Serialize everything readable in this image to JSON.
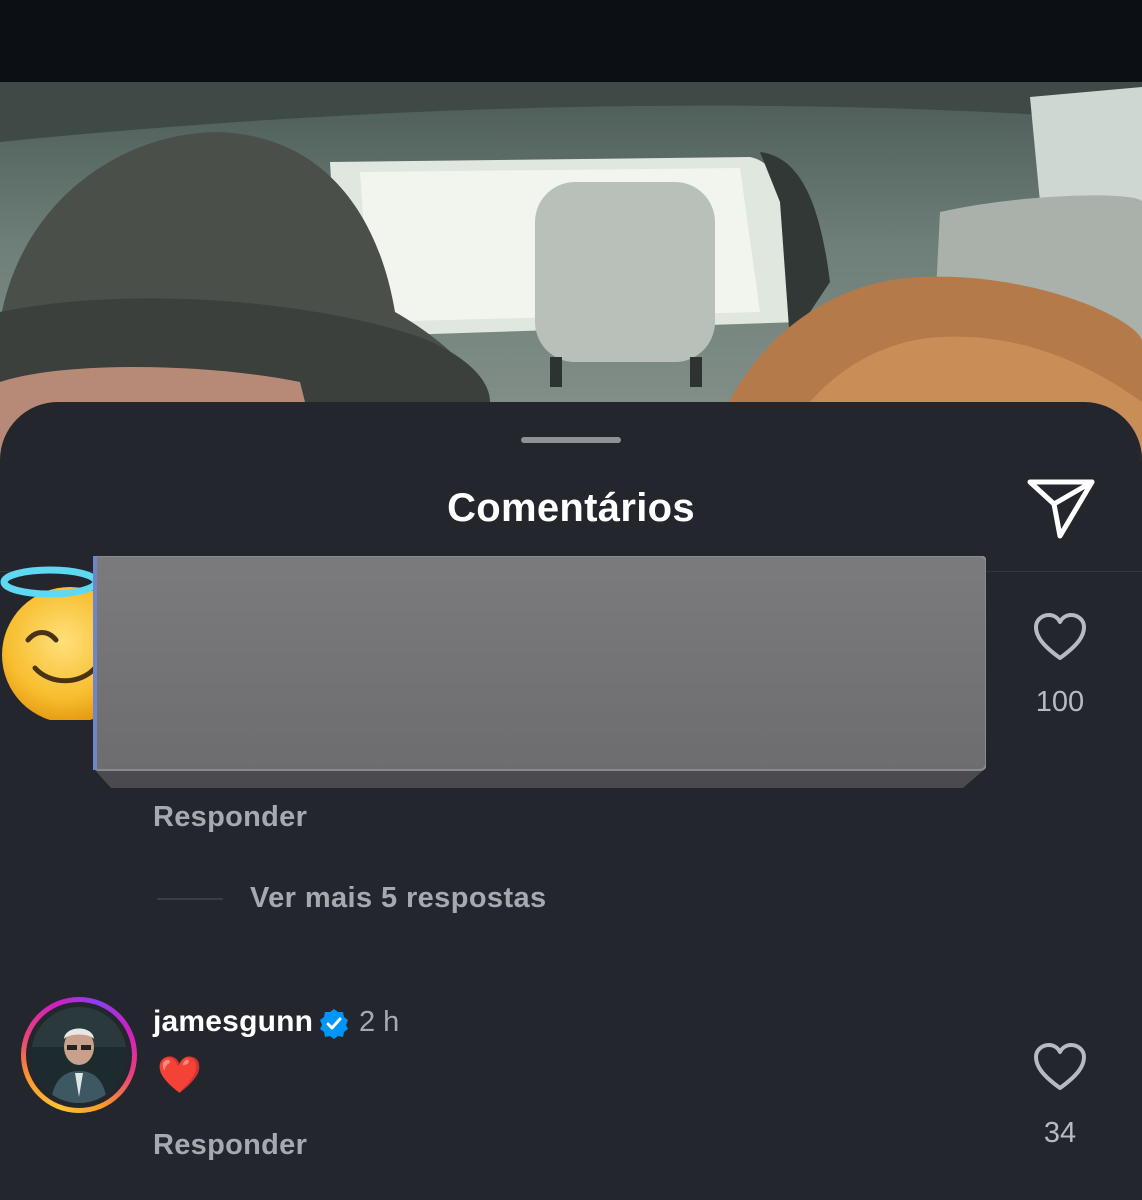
{
  "sheet": {
    "title": "Comentários"
  },
  "comments": [
    {
      "reply_label": "Responder",
      "like_count": "100",
      "more_replies_label": "Ver mais 5 respostas"
    },
    {
      "username": "jamesgunn",
      "time": "2 h",
      "text": "❤️",
      "reply_label": "Responder",
      "like_count": "34"
    }
  ],
  "colors": {
    "sheet_background": "#23262c",
    "verified_badge": "#0095f6",
    "secondary_text": "#a6aab0"
  }
}
